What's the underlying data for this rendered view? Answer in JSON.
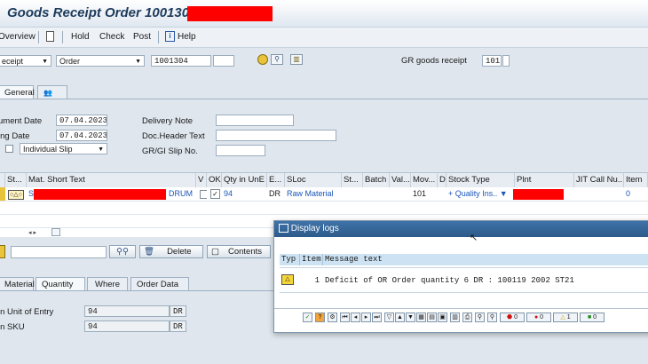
{
  "window": {
    "title": "Goods Receipt Order 1001304 -"
  },
  "toolbar": {
    "overview": "Overview",
    "hold": "Hold",
    "check": "Check",
    "post": "Post",
    "help": "Help"
  },
  "header": {
    "action": "eceipt",
    "ref_doc": "Order",
    "order_no": "1001304",
    "gr_label": "GR goods receipt",
    "mvt": "101"
  },
  "tabs": {
    "general": "General"
  },
  "general": {
    "doc_date_label": "ument Date",
    "doc_date": "07.04.2023",
    "post_date_label": "ing Date",
    "post_date": "07.04.2023",
    "slip_option": "Individual Slip",
    "delivery_note_label": "Delivery Note",
    "doc_header_label": "Doc.Header Text",
    "gr_slip_label": "GR/GI Slip No."
  },
  "grid": {
    "columns": [
      "St...",
      "Mat. Short Text",
      "V",
      "OK",
      "Qty in UnE",
      "E...",
      "SLoc",
      "St...",
      "Batch",
      "Val...",
      "Mov...",
      "D",
      "Stock Type",
      "Plnt",
      "JIT Call Nu...",
      "Item"
    ],
    "row": {
      "mat_prefix": "ST",
      "mat_suffix": "DRUM",
      "qty": "94",
      "unit": "DR",
      "sloc": "Raw Material",
      "mvt": "101",
      "stock_type": "+ Quality Ins..",
      "item": "0"
    }
  },
  "item_actions": {
    "delete": "Delete",
    "contents": "Contents"
  },
  "detail_tabs": {
    "material": "Material",
    "quantity": "Quantity",
    "where": "Where",
    "order_data": "Order Data"
  },
  "quantity": {
    "unit_entry_label": "in Unit of Entry",
    "unit_entry_value": "94",
    "unit_entry_uom": "DR",
    "sku_label": "in SKU",
    "sku_value": "94",
    "sku_uom": "DR"
  },
  "dialog": {
    "title": "Display logs",
    "col_typ": "Typ",
    "col_item": "Item",
    "col_msg": "Message text",
    "row_item": "1",
    "row_msg": "Deficit of OR Order quantity 6 DR : 100119 2002 ST21",
    "count_stop": "0",
    "count_error": "0",
    "count_warn": "1",
    "count_ok": "0"
  },
  "colors": {
    "accent": "#2c5a8a",
    "redaction": "#ff0000",
    "link": "#1c55b8",
    "header_bg": "#cde3f3"
  }
}
